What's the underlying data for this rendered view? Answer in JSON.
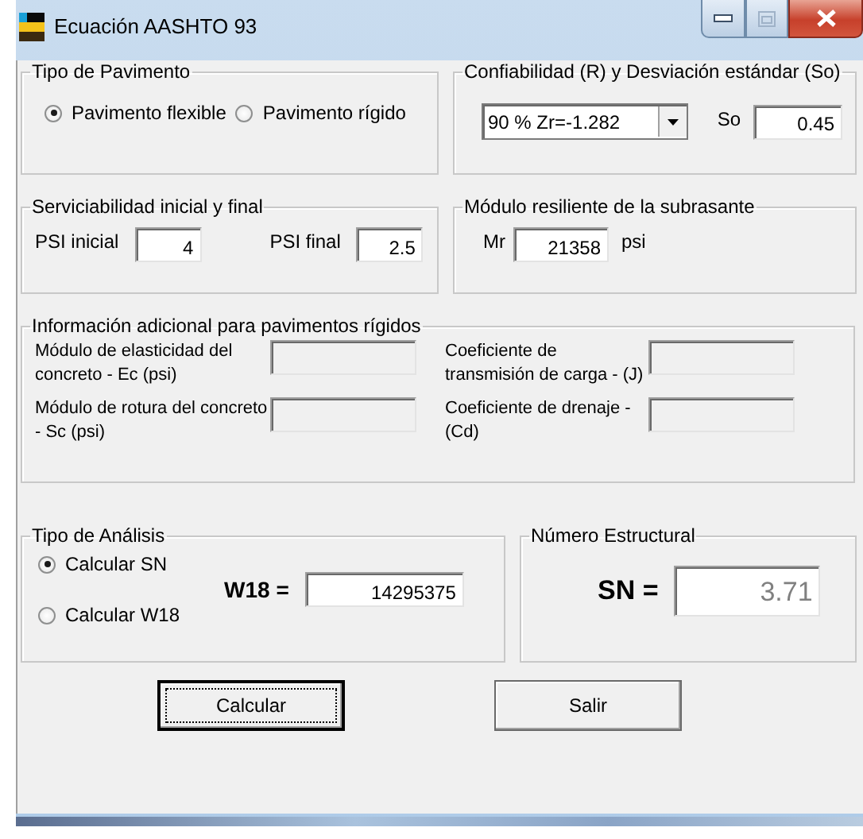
{
  "window": {
    "title": "Ecuación AASHTO 93"
  },
  "pavement_type": {
    "title": "Tipo de Pavimento",
    "options": [
      {
        "label": "Pavimento flexible",
        "selected": true
      },
      {
        "label": "Pavimento rígido",
        "selected": false
      }
    ]
  },
  "reliability": {
    "title": "Confiabilidad (R) y Desviación estándar (So)",
    "dropdown": {
      "value": "90 %  Zr=-1.282"
    },
    "so": {
      "label": "So",
      "value": "0.45"
    }
  },
  "serviceability": {
    "title": "Serviciabilidad inicial y final",
    "fields": [
      {
        "label": "PSI inicial",
        "value": "4"
      },
      {
        "label": "PSI final",
        "value": "2.5"
      }
    ]
  },
  "resilient_modulus": {
    "title": "Módulo resiliente de la subrasante",
    "label": "Mr",
    "value": "21358",
    "unit": "psi"
  },
  "rigid_info": {
    "title": "Información adicional para pavimentos rígidos",
    "fields": [
      {
        "label": "Módulo de elasticidad del concreto - Ec (psi)",
        "disabled": true
      },
      {
        "label": "Coeficiente de transmisión de carga - (J)",
        "disabled": true
      },
      {
        "label": "Módulo de rotura del concreto - Sc (psi)",
        "disabled": true
      },
      {
        "label": "Coeficiente de drenaje - (Cd)",
        "disabled": true
      }
    ]
  },
  "analysis": {
    "title": "Tipo de Análisis",
    "options": [
      {
        "label": "Calcular SN",
        "selected": true
      },
      {
        "label": "Calcular W18",
        "selected": false
      }
    ],
    "w18": {
      "label": "W18 =",
      "value": "14295375"
    }
  },
  "structural_number": {
    "title": "Número Estructural",
    "label": "SN =",
    "value": "3.71",
    "disabled": true
  },
  "buttons": [
    {
      "label": "Calcular",
      "focused": true
    },
    {
      "label": "Salir",
      "focused": false
    }
  ]
}
